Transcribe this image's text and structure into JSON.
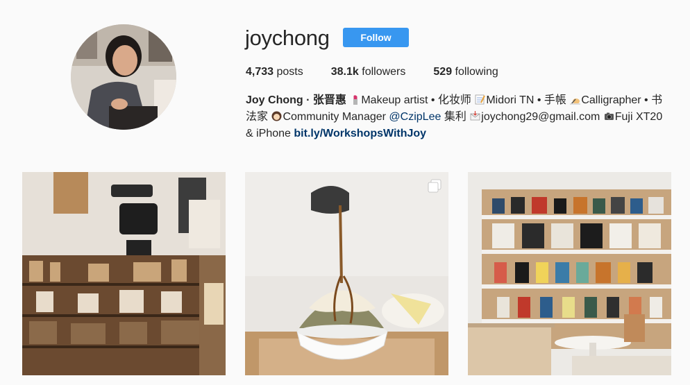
{
  "profile": {
    "username": "joychong",
    "follow_label": "Follow",
    "stats": {
      "posts_count": "4,733",
      "posts_label": "posts",
      "followers_count": "38.1k",
      "followers_label": "followers",
      "following_count": "529",
      "following_label": "following"
    },
    "bio": {
      "full_name": "Joy Chong · 张晋惠",
      "seg1": "Makeup artist • 化妆师",
      "seg2": "Midori TN • 手帳",
      "seg3": "Calligrapher • 书法家",
      "seg4": "Community Manager",
      "mention": "@CzipLee",
      "seg5": "集利",
      "seg6": "joychong29@gmail.com",
      "seg7": "Fuji XT20 & iPhone",
      "link": "bit.ly/WorkshopsWithJoy"
    }
  },
  "posts": [
    {
      "subject": "stationery-shop-interior",
      "multi": false
    },
    {
      "subject": "shaved-ice-dessert",
      "multi": true
    },
    {
      "subject": "bookstore-shelves",
      "multi": false
    }
  ],
  "colors": {
    "accent": "#3897f0",
    "link": "#003569",
    "background": "#fafafa",
    "text": "#262626"
  },
  "icons": [
    "lipstick-emoji",
    "memo-emoji",
    "writing-hand-emoji",
    "woman-emoji",
    "envelope-emoji",
    "camera-emoji",
    "multi-image-icon"
  ]
}
